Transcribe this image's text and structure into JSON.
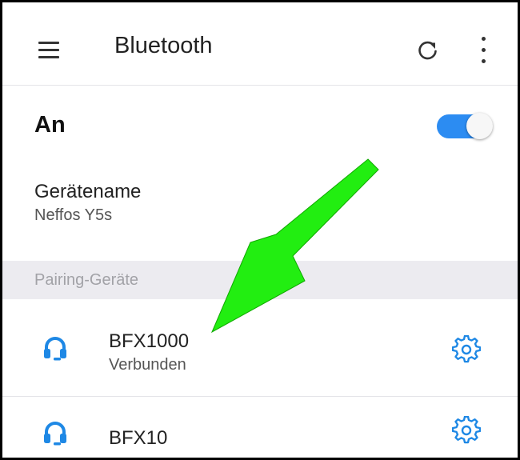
{
  "appbar": {
    "title": "Bluetooth",
    "icons": {
      "menu": "menu-icon",
      "refresh": "refresh-icon",
      "more": "more-vert-icon"
    }
  },
  "bluetooth": {
    "label": "An",
    "enabled": true
  },
  "device_name": {
    "label": "Gerätename",
    "value": "Neffos Y5s"
  },
  "paired_section": {
    "header": "Pairing-Geräte",
    "devices": [
      {
        "name": "BFX1000",
        "status": "Verbunden",
        "icon": "headset-icon",
        "settings_icon": "gear-icon"
      },
      {
        "name": "BFX10",
        "icon": "headset-icon",
        "settings_icon": "gear-icon"
      }
    ]
  },
  "colors": {
    "accent": "#2c8cf2",
    "arrow": "#22ee11",
    "section_bg": "#ecebf0"
  }
}
